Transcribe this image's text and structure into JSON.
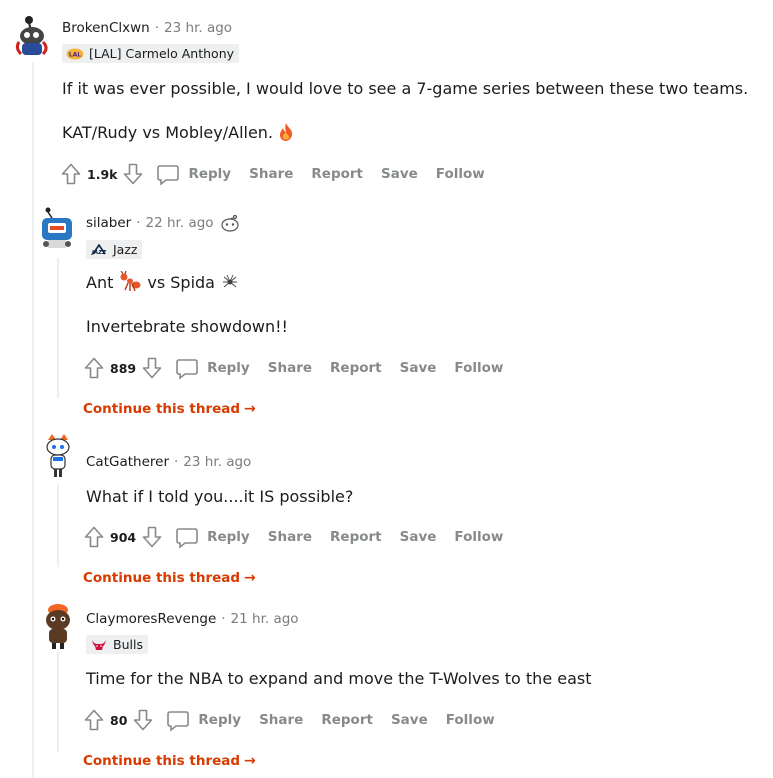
{
  "comments": [
    {
      "username": "BrokenClxwn",
      "time": "23 hr. ago",
      "flair": "[LAL] Carmelo Anthony",
      "lines": [
        "If it was ever possible, I would love to see a 7-game series between these two teams.",
        "KAT/Rudy vs Mobley/Allen."
      ],
      "score": "1.9k",
      "actions": [
        "Reply",
        "Share",
        "Report",
        "Save",
        "Follow"
      ]
    },
    {
      "username": "silaber",
      "time": "22 hr. ago",
      "flair": "Jazz",
      "line1_a": "Ant",
      "line1_b": "vs Spida",
      "line2": "Invertebrate showdown!!",
      "score": "889",
      "actions": [
        "Reply",
        "Share",
        "Report",
        "Save",
        "Follow"
      ],
      "continue": "Continue this thread"
    },
    {
      "username": "CatGatherer",
      "time": "23 hr. ago",
      "line": "What if I told you....it IS possible?",
      "score": "904",
      "actions": [
        "Reply",
        "Share",
        "Report",
        "Save",
        "Follow"
      ],
      "continue": "Continue this thread"
    },
    {
      "username": "ClaymoresRevenge",
      "time": "21 hr. ago",
      "flair": "Bulls",
      "line": "Time for the NBA to expand and move the T-Wolves to the east",
      "score": "80",
      "actions": [
        "Reply",
        "Share",
        "Report",
        "Save",
        "Follow"
      ],
      "continue": "Continue this thread"
    }
  ],
  "separator": "·",
  "colors": {
    "accent": "#d93a00",
    "muted": "#878a8c",
    "thread": "#edeff1"
  },
  "icons": [
    "upvote-icon",
    "downvote-icon",
    "reply-icon",
    "fire-icon",
    "ant-icon",
    "spider-icon",
    "arrow-right-icon"
  ]
}
